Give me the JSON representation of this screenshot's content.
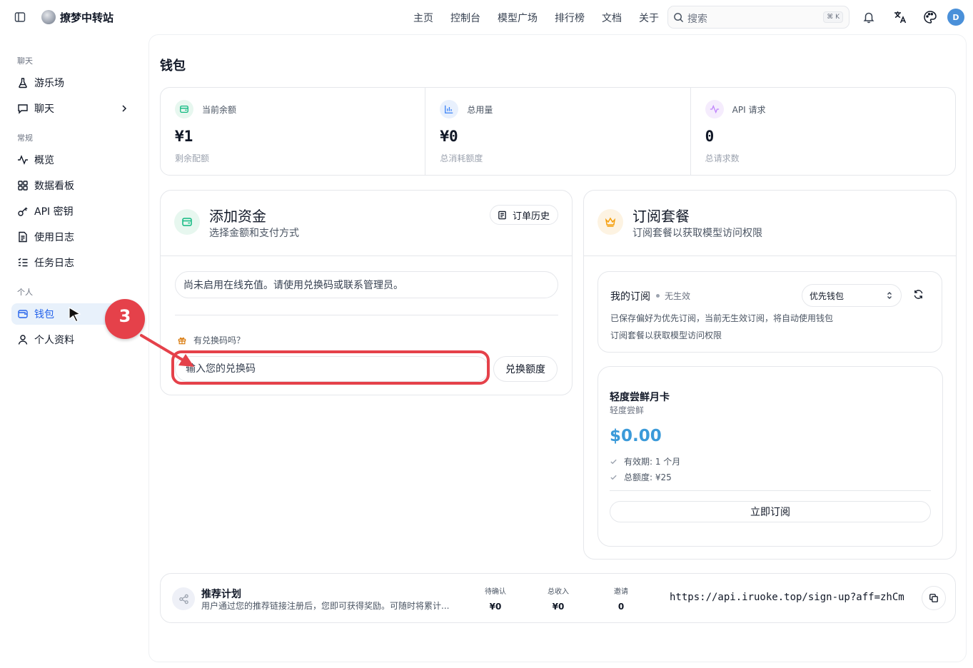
{
  "header": {
    "site_name": "撩梦中转站",
    "nav": [
      "主页",
      "控制台",
      "模型广场",
      "排行榜",
      "文档",
      "关于"
    ],
    "search": {
      "placeholder": "搜索",
      "shortcut": "⌘ K"
    },
    "avatar_initial": "D"
  },
  "sidebar": {
    "sections": {
      "chat": "聊天",
      "general": "常规",
      "personal": "个人"
    },
    "items": {
      "playground": "游乐场",
      "chat": "聊天",
      "overview": "概览",
      "dashboard": "数据看板",
      "api_keys": "API 密钥",
      "usage_log": "使用日志",
      "task_log": "任务日志",
      "wallet": "钱包",
      "profile": "个人资料"
    },
    "active": "wallet"
  },
  "page": {
    "title": "钱包"
  },
  "stats": [
    {
      "label": "当前余额",
      "value": "¥1",
      "sub": "剩余配额",
      "color": "#10b981",
      "icon": "wallet-icon"
    },
    {
      "label": "总用量",
      "value": "¥0",
      "sub": "总消耗额度",
      "color": "#3b82f6",
      "icon": "bar-chart-icon"
    },
    {
      "label": "API 请求",
      "value": "0",
      "sub": "总请求数",
      "color": "#a855f7",
      "icon": "activity-icon"
    }
  ],
  "add_funds": {
    "title": "添加资金",
    "subtitle": "选择金额和支付方式",
    "order_history": "订单历史",
    "notice": "尚未启用在线充值。请使用兑换码或联系管理员。",
    "redeem_label": "有兑换码吗？",
    "redeem_placeholder": "输入您的兑换码",
    "redeem_button": "兑换额度"
  },
  "subscription": {
    "title": "订阅套餐",
    "subtitle": "订阅套餐以获取模型访问权限",
    "my_sub": {
      "title": "我的订阅",
      "status": "无生效",
      "select": "优先钱包",
      "desc1": "已保存偏好为优先订阅，当前无生效订阅，将自动使用钱包",
      "desc2": "订阅套餐以获取模型访问权限"
    },
    "plan": {
      "name": "轻度尝鲜月卡",
      "tag": "轻度尝鲜",
      "price": "$0.00",
      "features": [
        "有效期: 1 个月",
        "总额度: ¥25"
      ],
      "button": "立即订阅"
    }
  },
  "referral": {
    "title": "推荐计划",
    "desc": "用户通过您的推荐链接注册后，您即可获得奖励。可随时将累计...",
    "stats": [
      {
        "label": "待确认",
        "value": "¥0"
      },
      {
        "label": "总收入",
        "value": "¥0"
      },
      {
        "label": "邀请",
        "value": "0"
      }
    ],
    "link": "https://api.iruoke.top/sign-up?aff=zhCm"
  },
  "annotation": {
    "step": "3",
    "color": "#e5414a"
  }
}
